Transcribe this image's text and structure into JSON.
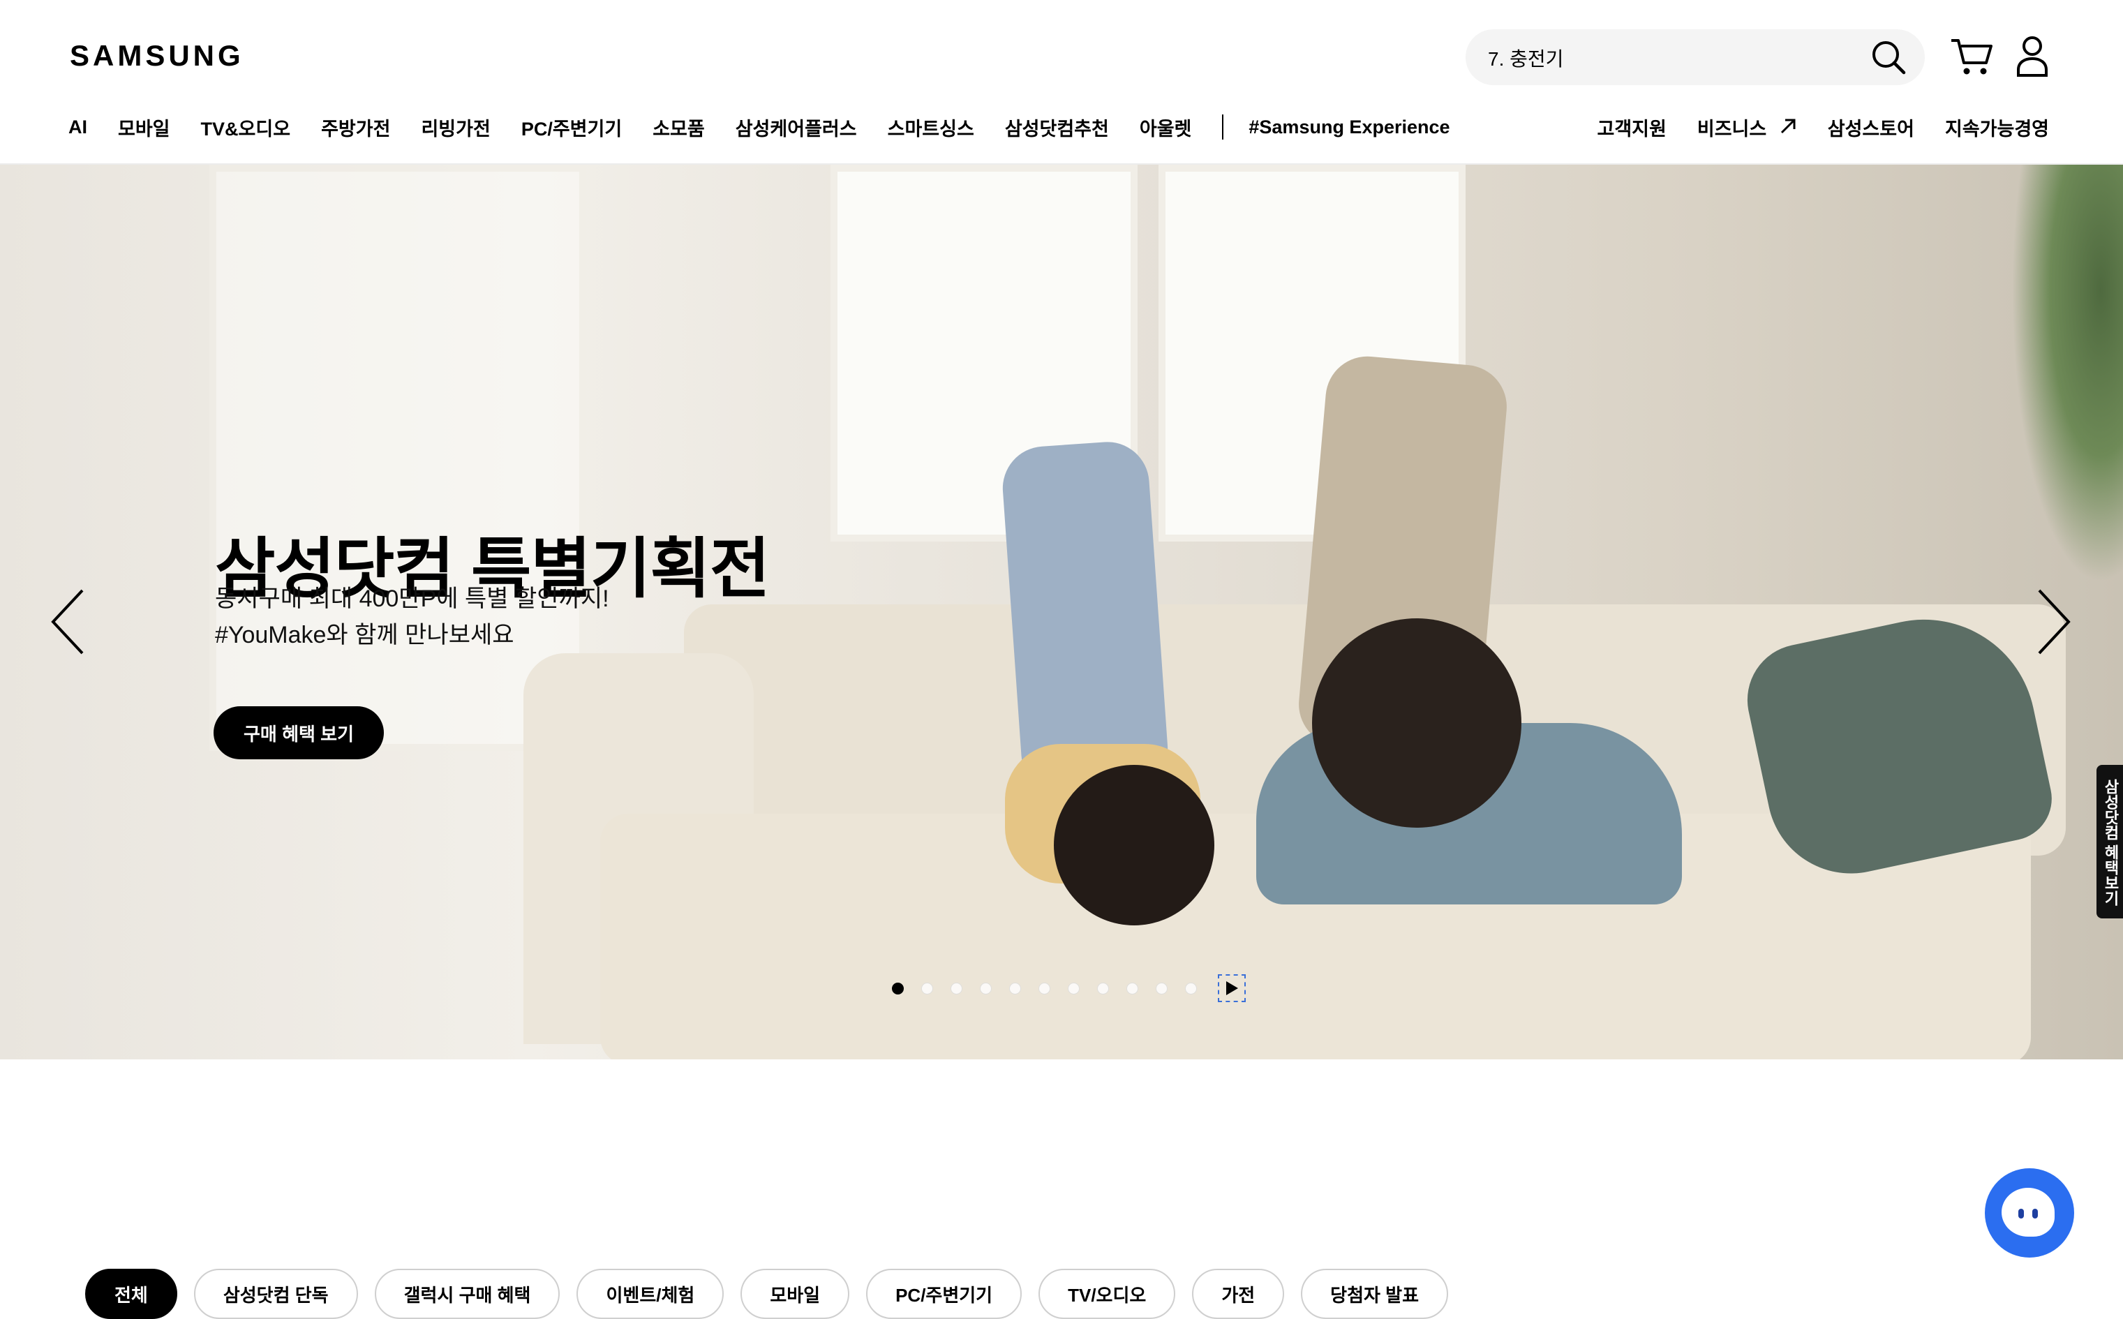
{
  "header": {
    "logo": "SAMSUNG",
    "search_value": "7. 충전기",
    "nav_left": [
      "AI",
      "모바일",
      "TV&오디오",
      "주방가전",
      "리빙가전",
      "PC/주변기기",
      "소모품",
      "삼성케어플러스",
      "스마트싱스",
      "삼성닷컴추천",
      "아울렛",
      "#Samsung Experience"
    ],
    "nav_right": [
      "고객지원",
      "비즈니스",
      "삼성스토어",
      "지속가능경영"
    ]
  },
  "hero": {
    "title": "삼성닷컴 특별기획전",
    "subtitle_line1": "동시구매 최대 400만P에 특별 할인까지!",
    "subtitle_line2": "#YouMake와 함께 만나보세요",
    "button_label": "구매 혜택 보기",
    "slide_count": 11,
    "active_slide": 1
  },
  "side_tab": {
    "label": "삼성닷컴 혜택보기"
  },
  "filters": [
    "전체",
    "삼성닷컴 단독",
    "갤럭시 구매 혜택",
    "이벤트/체험",
    "모바일",
    "PC/주변기기",
    "TV/오디오",
    "가전",
    "당첨자 발표"
  ],
  "colors": {
    "accent": "#000000",
    "chat": "#2b6ef0"
  }
}
